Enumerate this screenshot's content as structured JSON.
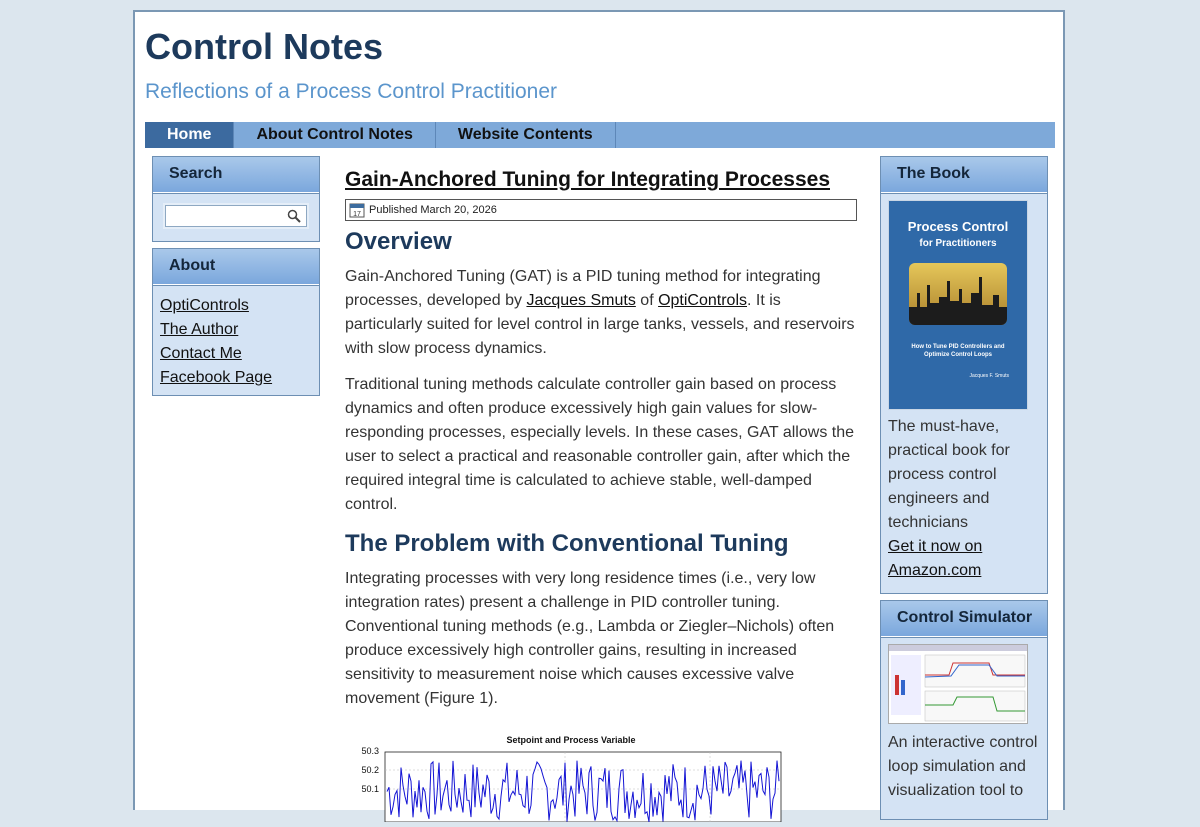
{
  "site": {
    "title": "Control Notes",
    "description": "Reflections of a Process Control Practitioner"
  },
  "nav": [
    {
      "label": "Home",
      "active": true
    },
    {
      "label": "About Control Notes",
      "active": false
    },
    {
      "label": "Website Contents",
      "active": false
    }
  ],
  "left_sidebar": {
    "search": {
      "title": "Search",
      "placeholder": ""
    },
    "about": {
      "title": "About",
      "links": [
        "OptiControls",
        "The Author",
        "Contact Me",
        "Facebook Page"
      ]
    }
  },
  "right_sidebar": {
    "book": {
      "title": "The Book",
      "cover": {
        "title_line1": "Process Control",
        "title_line2": "for Practitioners",
        "subtitle": "How to Tune PID Controllers and Optimize Control Loops",
        "author": "Jacques F. Smuts"
      },
      "text": "The must-have, practical book for process control engineers and technicians",
      "link": "Get it now on Amazon.com"
    },
    "simulator": {
      "title": "Control Simulator",
      "text": "An interactive control loop simulation and visualization tool to"
    }
  },
  "post": {
    "title": "Gain-Anchored Tuning for Integrating Processes",
    "published": "Published March 20, 2026",
    "calendar_day": "17",
    "sections": {
      "overview_heading": "Overview",
      "p1_a": "Gain-Anchored Tuning (GAT) is a PID tuning method for integrating processes, developed by ",
      "p1_link1": "Jacques Smuts",
      "p1_b": " of ",
      "p1_link2": "OptiControls",
      "p1_c": ". It is particularly suited for level control in large tanks, vessels, and reservoirs with slow process dynamics.",
      "p2": "Traditional tuning methods calculate controller gain based on process dynamics and often produce excessively high gain values for slow-responding processes, especially levels. In these cases, GAT allows the user to select a practical and reasonable controller gain, after which the required integral time is calculated to achieve stable, well-damped control.",
      "problem_heading": "The Problem with Conventional Tuning",
      "p3": "Integrating processes with very long residence times (i.e., very low integration rates) present a challenge in PID controller tuning. Conventional tuning methods (e.g., Lambda or Ziegler–Nichols) often produce excessively high controller gains, resulting in increased sensitivity to measurement noise which causes excessive valve movement (Figure 1)."
    },
    "figure": {
      "title": "Setpoint and Process Variable",
      "y_ticks": [
        "50.3",
        "50.2",
        "50.1"
      ]
    }
  },
  "colors": {
    "nav_bg": "#7ea9d9",
    "nav_active": "#3c6a9f",
    "title": "#1d3a5c",
    "tagline": "#5b95cc",
    "widget_bg": "#d4e3f4"
  }
}
